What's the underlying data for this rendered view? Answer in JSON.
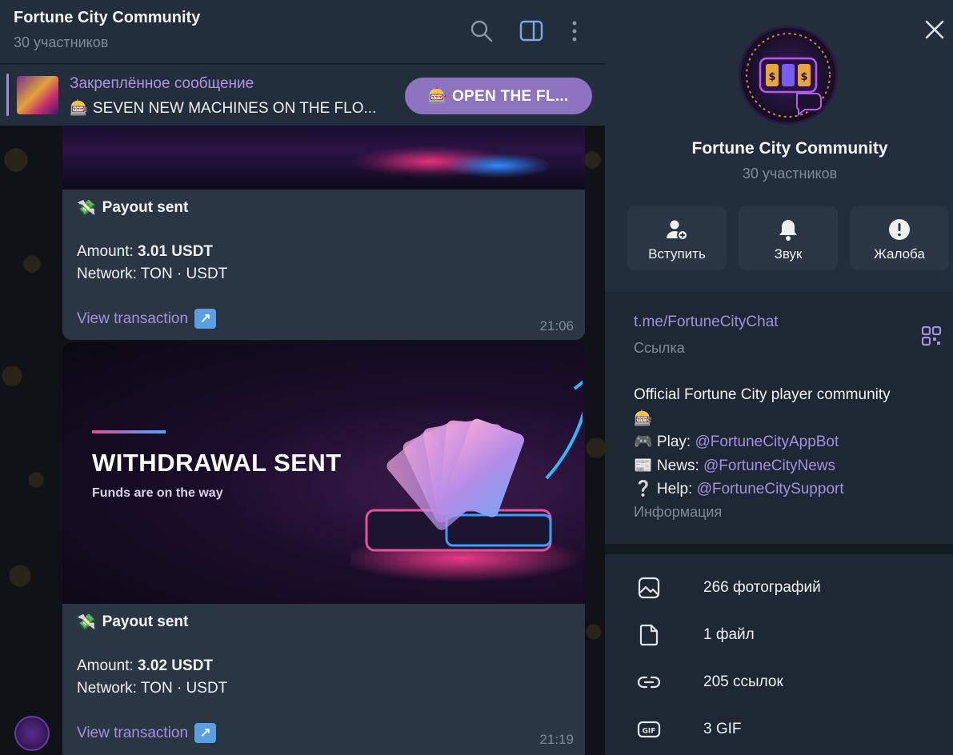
{
  "chat": {
    "title": "Fortune City Community",
    "subtitle": "30 участников",
    "pinned": {
      "title": "Закреплённое сообщение",
      "text": "🎰 SEVEN NEW MACHINES ON THE FLO...",
      "button": "🎰 OPEN THE FL..."
    },
    "messages": [
      {
        "title": "Payout sent",
        "amount_label": "Amount:",
        "amount": "3.01 USDT",
        "network": "Network: TON · USDT",
        "link": "View transaction",
        "time": "21:06"
      },
      {
        "title": "Payout sent",
        "amount_label": "Amount:",
        "amount": "3.02 USDT",
        "network": "Network: TON · USDT",
        "link": "View transaction",
        "time": "21:19"
      }
    ],
    "poster": {
      "title": "WITHDRAWAL SENT",
      "subtitle": "Funds are on the way"
    }
  },
  "panel": {
    "title": "Fortune City Community",
    "subtitle": "30 участников",
    "actions": [
      {
        "label": "Вступить",
        "icon": "add-user-icon"
      },
      {
        "label": "Звук",
        "icon": "bell-icon"
      },
      {
        "label": "Жалоба",
        "icon": "report-icon"
      }
    ],
    "link": "t.me/FortuneCityChat",
    "link_label": "Ссылка",
    "description": {
      "line1": "Official Fortune City player community",
      "line2": "🎰",
      "play_prefix": "🎮 Play: ",
      "play_link": "@FortuneCityAppBot",
      "news_prefix": "📰 News: ",
      "news_link": "@FortuneCityNews",
      "help_prefix": "❔ Help: ",
      "help_link": "@FortuneCitySupport"
    },
    "info_label": "Информация",
    "media": [
      {
        "label": "266 фотографий",
        "icon": "photo-icon"
      },
      {
        "label": "1 файл",
        "icon": "file-icon"
      },
      {
        "label": "205 ссылок",
        "icon": "link-icon"
      },
      {
        "label": "3 GIF",
        "icon": "gif-icon"
      }
    ]
  },
  "colors": {
    "accent": "#a48fe0",
    "button": "#8e74c0",
    "bubble": "#2b3645",
    "panel": "#17212b"
  }
}
